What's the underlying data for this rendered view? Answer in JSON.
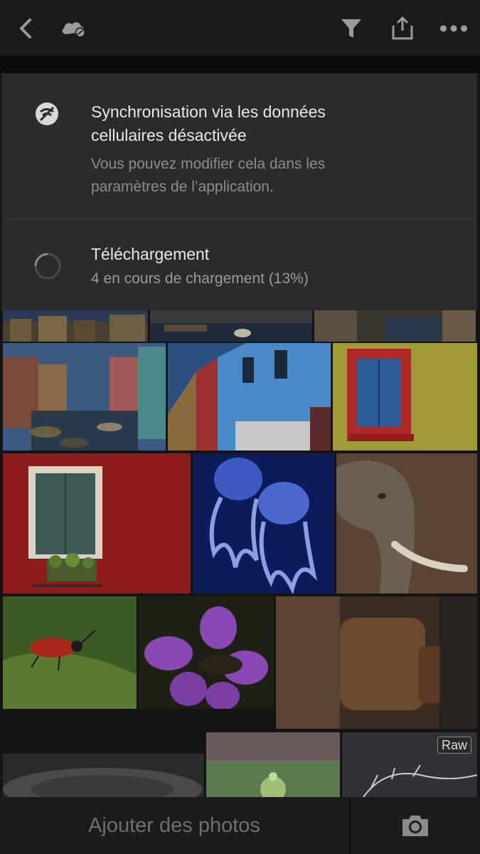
{
  "toolbar": {
    "icons": [
      "back-chevron-icon",
      "cloud-sync-disabled-icon",
      "filter-icon",
      "share-icon",
      "more-icon"
    ]
  },
  "sync_notice": {
    "title": "Synchronisation via les données cellulaires désactivée",
    "subtitle": "Vous pouvez modifier cela dans les paramètres de l’application."
  },
  "download": {
    "title": "Téléchargement",
    "status": "4 en cours de chargement  (13%)",
    "progress": 0.13
  },
  "grid": {
    "raw_badge": "Raw"
  },
  "bottom_bar": {
    "add_label": "Ajouter des photos"
  },
  "colors": {
    "panel": "#2b2b2b",
    "background": "#141414",
    "topbar": "#1a1a1a"
  }
}
